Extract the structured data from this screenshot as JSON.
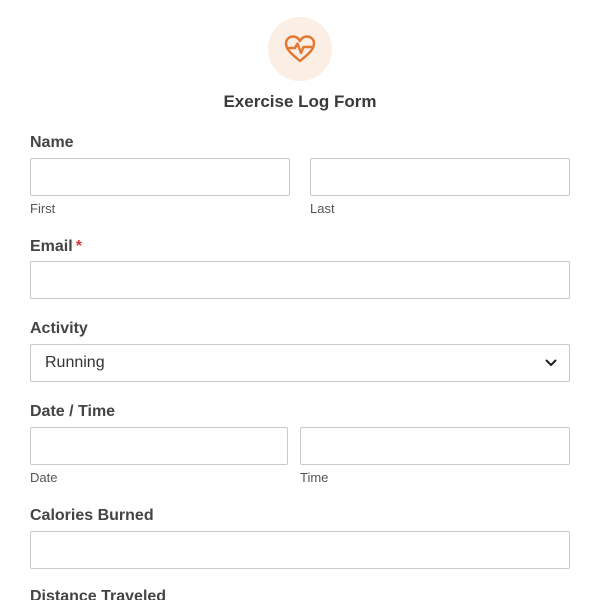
{
  "form": {
    "title": "Exercise Log Form",
    "logo_icon": "heart-pulse-icon",
    "accent_color": "#e27730",
    "accent_bg": "#fbeee5",
    "required_color": "#d63637"
  },
  "name": {
    "label": "Name",
    "first_value": "",
    "last_value": "",
    "first_sublabel": "First",
    "last_sublabel": "Last"
  },
  "email": {
    "label": "Email",
    "required_mark": "*",
    "value": ""
  },
  "activity": {
    "label": "Activity",
    "selected": "Running",
    "icon": "chevron-down-icon"
  },
  "datetime": {
    "label": "Date / Time",
    "date_value": "",
    "time_value": "",
    "date_sublabel": "Date",
    "time_sublabel": "Time"
  },
  "calories": {
    "label": "Calories Burned",
    "value": ""
  },
  "distance": {
    "label": "Distance Traveled"
  }
}
